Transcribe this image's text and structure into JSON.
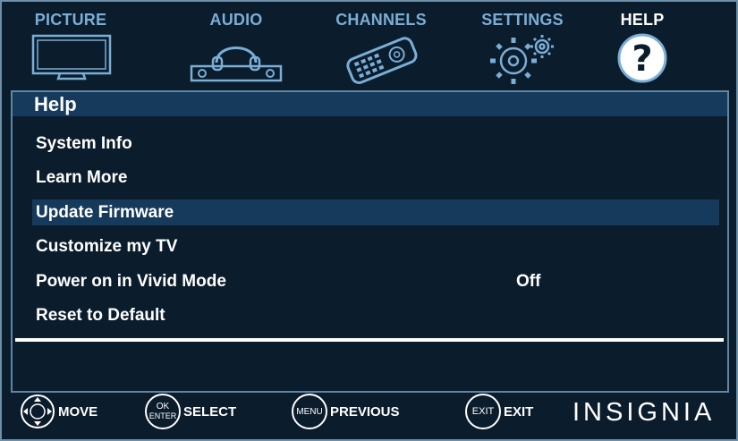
{
  "tabs": [
    {
      "label": "PICTURE",
      "icon": "tv-icon",
      "active": false
    },
    {
      "label": "AUDIO",
      "icon": "headphones-speaker-icon",
      "active": false
    },
    {
      "label": "CHANNELS",
      "icon": "remote-control-icon",
      "active": false
    },
    {
      "label": "SETTINGS",
      "icon": "gears-icon",
      "active": false
    },
    {
      "label": "HELP",
      "icon": "question-mark-icon",
      "active": true
    }
  ],
  "panel": {
    "title": "Help",
    "items": [
      {
        "label": "System Info",
        "value": ""
      },
      {
        "label": "Learn More",
        "value": ""
      },
      {
        "label": "Update Firmware",
        "value": "",
        "selected": true
      },
      {
        "label": "Customize my TV",
        "value": ""
      },
      {
        "label": "Power on in Vivid Mode",
        "value": "Off"
      },
      {
        "label": "Reset to Default",
        "value": ""
      }
    ]
  },
  "footer": {
    "move": "MOVE",
    "select": "SELECT",
    "select_btn_top": "OK",
    "select_btn_bottom": "ENTER",
    "previous": "PREVIOUS",
    "menu_btn": "MENU",
    "exit": "EXIT",
    "exit_btn": "EXIT",
    "brand": "INSIGNIA"
  },
  "colors": {
    "background": "#0b1c2c",
    "highlight": "#163a5b",
    "tab_inactive": "#7aaed6",
    "tab_active": "#ffffff",
    "border": "#5f86a5"
  }
}
